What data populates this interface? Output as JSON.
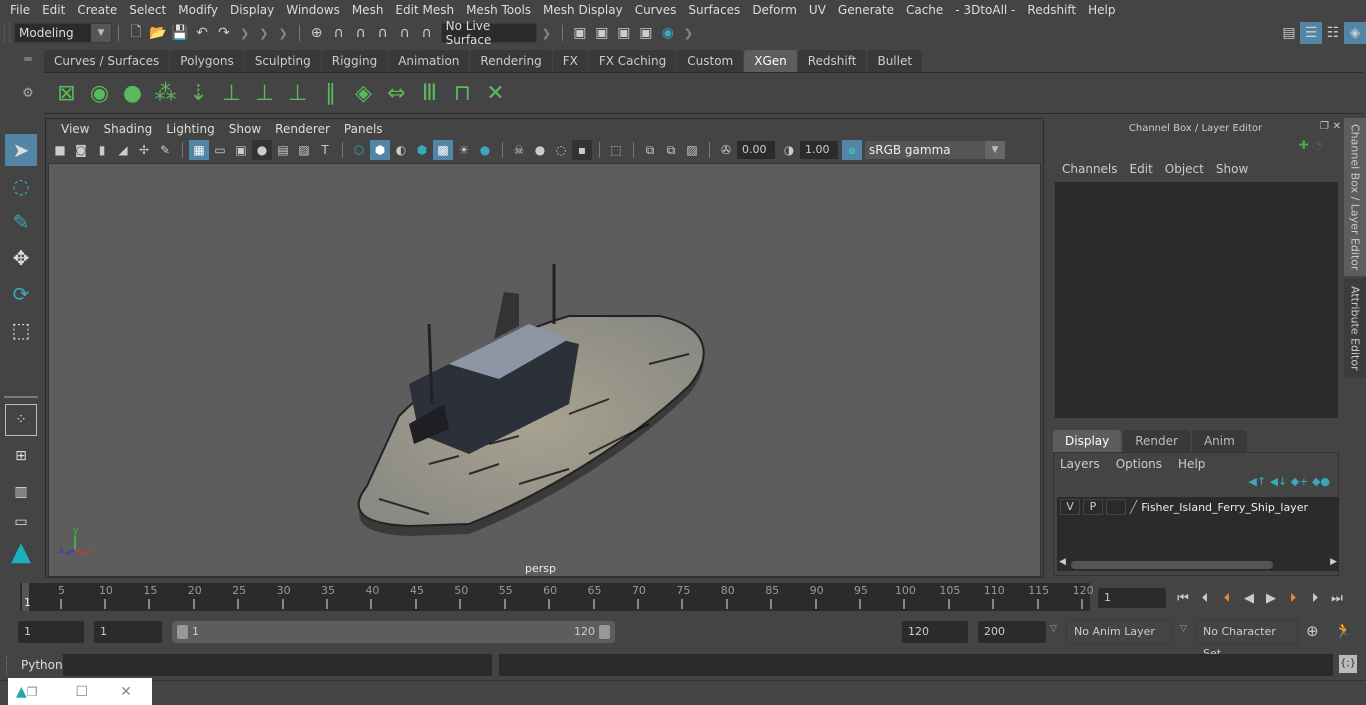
{
  "menubar": [
    "File",
    "Edit",
    "Create",
    "Select",
    "Modify",
    "Display",
    "Windows",
    "Mesh",
    "Edit Mesh",
    "Mesh Tools",
    "Mesh Display",
    "Curves",
    "Surfaces",
    "Deform",
    "UV",
    "Generate",
    "Cache",
    "- 3DtoAll -",
    "Redshift",
    "Help"
  ],
  "statusline": {
    "workspace": "Modeling",
    "live_surface": "No Live Surface"
  },
  "shelf": {
    "tabs": [
      "Curves / Surfaces",
      "Polygons",
      "Sculpting",
      "Rigging",
      "Animation",
      "Rendering",
      "FX",
      "FX Caching",
      "Custom",
      "XGen",
      "Redshift",
      "Bullet"
    ],
    "active_tab": "XGen",
    "icons": [
      "xgen-editor-icon",
      "preview-visible-icon",
      "preview-hidden-icon",
      "add-guides-icon",
      "place-guides-icon",
      "add-guide-icon",
      "show-guides-icon",
      "lock-guides-icon",
      "split-guide-icon",
      "sculpt-layer-icon",
      "flip-guides-icon",
      "select-guides-icon",
      "guide-bounds-icon",
      "delete-guides-icon"
    ]
  },
  "panel": {
    "menu": [
      "View",
      "Shading",
      "Lighting",
      "Show",
      "Renderer",
      "Panels"
    ],
    "exposure": "0.00",
    "gamma": "1.00",
    "color_mgmt": "ON",
    "colorspace": "sRGB gamma",
    "camera_label": "persp",
    "axis": {
      "x": "x",
      "y": "y",
      "z": "z"
    }
  },
  "channel_box": {
    "title": "Channel Box / Layer Editor",
    "menu": [
      "Channels",
      "Edit",
      "Object",
      "Show"
    ]
  },
  "layer_editor": {
    "tabs": [
      "Display",
      "Render",
      "Anim"
    ],
    "active_tab": "Display",
    "menu": [
      "Layers",
      "Options",
      "Help"
    ],
    "layers": [
      {
        "v": "V",
        "p": "P",
        "name": "Fisher_Island_Ferry_Ship_layer"
      }
    ]
  },
  "side_tabs": [
    "Channel Box / Layer Editor",
    "Attribute Editor"
  ],
  "timeline": {
    "ticks": [
      5,
      10,
      15,
      20,
      25,
      30,
      35,
      40,
      45,
      50,
      55,
      60,
      65,
      70,
      75,
      80,
      85,
      90,
      95,
      100,
      105,
      110,
      115,
      120
    ],
    "current_frame_marker": "1",
    "current_frame": "1"
  },
  "range": {
    "start": "1",
    "anim_start": "1",
    "slider_start": "1",
    "slider_end": "120",
    "anim_end": "120",
    "end": "200",
    "anim_layer": "No Anim Layer",
    "character_set": "No Character Set"
  },
  "cmdline": {
    "language": "Python"
  },
  "colors": {
    "accent": "#5285a6",
    "xgen_green": "#5cb85c",
    "viewport_bg": "#5d5d5d",
    "teal": "#3aa8b8"
  }
}
